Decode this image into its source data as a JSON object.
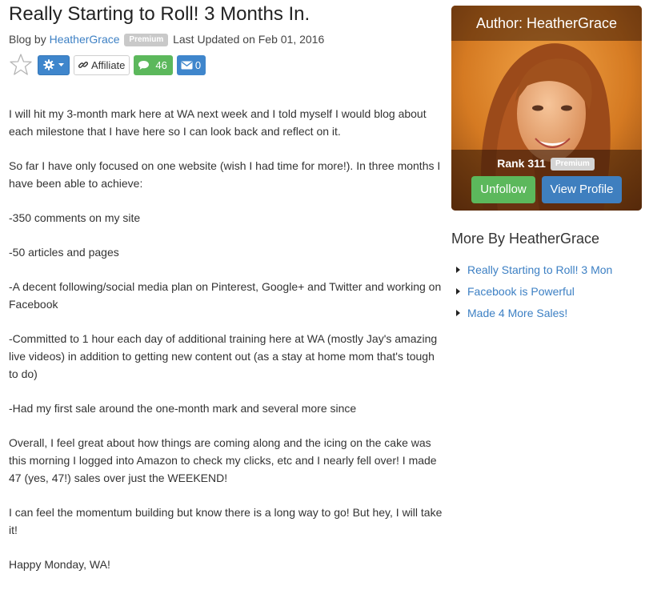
{
  "post": {
    "title": "Really Starting to Roll! 3 Months In.",
    "meta_prefix": "Blog by",
    "author_link": "HeatherGrace",
    "premium_badge": "Premium",
    "updated": "Last Updated on Feb 01, 2016",
    "paragraphs": [
      "I will hit my 3-month mark here at WA next week and I told myself I would blog about each milestone that I have here so I can look back and reflect on it.",
      "So far I have only focused on one website (wish I had time for more!). In three months I have been able to achieve:",
      "-350 comments on my site",
      "-50 articles and pages",
      "-A decent following/social media plan on Pinterest, Google+ and Twitter and working on Facebook",
      "-Committed to 1 hour each day of additional training here at WA (mostly Jay's amazing live videos) in addition to getting new content out (as a stay at home mom that's tough to do)",
      "-Had my first sale around the one-month mark and several more since",
      "Overall, I feel great about how things are coming along and the icing on the cake was this morning I logged into Amazon to check my clicks, etc and I nearly fell over! I made 47 (yes, 47!) sales over just the WEEKEND!",
      "I can feel the momentum building but know there is a long way to go! But hey, I will take it!",
      "Happy Monday, WA!"
    ]
  },
  "toolbar": {
    "star_icon": "star-outline-icon",
    "gear_icon": "gear-icon",
    "affiliate_label": "Affiliate",
    "comments_count": "46",
    "mail_count": "0",
    "colors": {
      "blue": "#3f86cc",
      "green": "#5cb85c"
    }
  },
  "author_card": {
    "header": "Author: HeatherGrace",
    "rank": "Rank 311",
    "premium_badge": "Premium",
    "unfollow_label": "Unfollow",
    "view_profile_label": "View Profile"
  },
  "more_by": {
    "heading": "More By HeatherGrace",
    "items": [
      "Really Starting to Roll! 3 Mon",
      "Facebook is Powerful",
      "Made 4 More Sales!"
    ]
  }
}
